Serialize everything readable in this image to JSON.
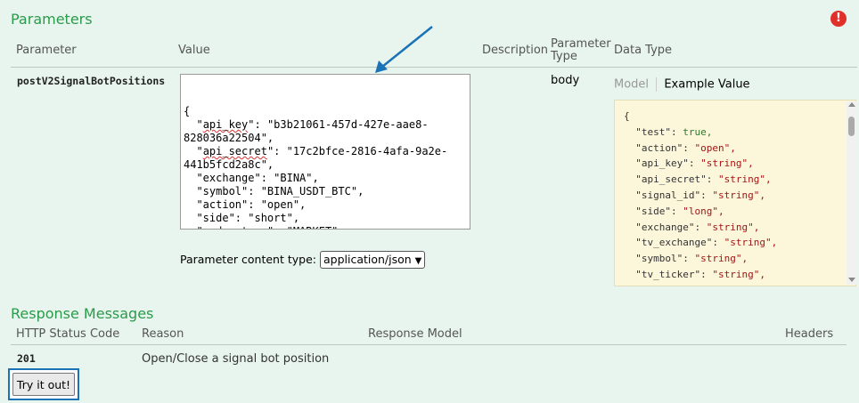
{
  "parameters": {
    "title": "Parameters",
    "error_icon": "!",
    "headers": {
      "parameter": "Parameter",
      "value": "Value",
      "description": "Description",
      "parameter_type_line1": "Parameter",
      "parameter_type_line2": "Type",
      "data_type": "Data Type"
    },
    "row": {
      "name": "postV2SignalBotPositions",
      "type": "body",
      "value_lines": [
        "{",
        "  \"api_key\": \"b3b21061-457d-427e-aae8-",
        "828036a22504\",",
        "  \"api_secret\": \"17c2bfce-2816-4afa-9a2e-",
        "441b5fcd2a8c\",",
        "  \"exchange\": \"BINA\",",
        "  \"symbol\": \"BINA_USDT_BTC\",",
        "  \"action\": \"open\",",
        "  \"side\": \"short\",",
        "  \"order_type\": \"MARKET\"",
        "}"
      ],
      "content_type_label": "Parameter content type:",
      "content_type_value": "application/json"
    },
    "data_type_tabs": {
      "model": "Model",
      "example": "Example Value"
    },
    "example_value": [
      {
        "key": "{",
        "val": "",
        "kind": "punct"
      },
      {
        "key": "  \"test\": ",
        "val": "true,",
        "kind": "bool"
      },
      {
        "key": "  \"action\": ",
        "val": "\"open\",",
        "kind": "str"
      },
      {
        "key": "  \"api_key\": ",
        "val": "\"string\",",
        "kind": "str"
      },
      {
        "key": "  \"api_secret\": ",
        "val": "\"string\",",
        "kind": "str"
      },
      {
        "key": "  \"signal_id\": ",
        "val": "\"string\",",
        "kind": "str"
      },
      {
        "key": "  \"side\": ",
        "val": "\"long\",",
        "kind": "str"
      },
      {
        "key": "  \"exchange\": ",
        "val": "\"string\",",
        "kind": "str"
      },
      {
        "key": "  \"tv_exchange\": ",
        "val": "\"string\",",
        "kind": "str"
      },
      {
        "key": "  \"symbol\": ",
        "val": "\"string\",",
        "kind": "str"
      },
      {
        "key": "  \"tv_ticker\": ",
        "val": "\"string\",",
        "kind": "str"
      }
    ]
  },
  "responses": {
    "title": "Response Messages",
    "headers": {
      "status": "HTTP Status Code",
      "reason": "Reason",
      "model": "Response Model",
      "headers": "Headers"
    },
    "rows": [
      {
        "code": "201",
        "reason": "Open/Close a signal bot position"
      }
    ]
  },
  "try_button": "Try it out!",
  "colors": {
    "section_title": "#2b9a4b",
    "annotation_arrow": "#1a73b7",
    "background": "#e8f5ee"
  }
}
